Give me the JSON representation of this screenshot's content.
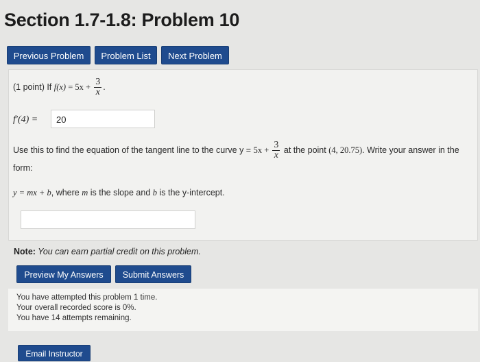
{
  "page": {
    "title": "Section 1.7-1.8: Problem 10"
  },
  "nav": {
    "previous": "Previous Problem",
    "list": "Problem List",
    "next": "Next Problem"
  },
  "problem": {
    "points": "(1 point) If ",
    "fx": "f(x)",
    "eq": " = 5x + ",
    "frac_num": "3",
    "frac_den": "x",
    "comma": ".",
    "deriv_label": "f′(4) = ",
    "deriv_answer": "20",
    "tangent_text_1": "Use this to find the equation of the tangent line to the curve y = ",
    "tangent_math": "5x + ",
    "tangent_text_2": " at the point ",
    "point": "(4, 20.75)",
    "tangent_text_3": ". Write your answer in the",
    "form_label": "form:",
    "form_eq": "y = mx + b",
    "form_text_1": ", where ",
    "form_m": "m",
    "form_text_2": " is the slope and ",
    "form_b": "b",
    "form_text_3": " is the y-intercept.",
    "answer_value": ""
  },
  "note": {
    "label": "Note:",
    "text": " You can earn partial credit on this problem."
  },
  "actions": {
    "preview": "Preview My Answers",
    "submit": "Submit Answers",
    "email": "Email Instructor"
  },
  "status": {
    "line1": "You have attempted this problem 1 time.",
    "line2": "Your overall recorded score is 0%.",
    "line3": "You have 14 attempts remaining."
  }
}
